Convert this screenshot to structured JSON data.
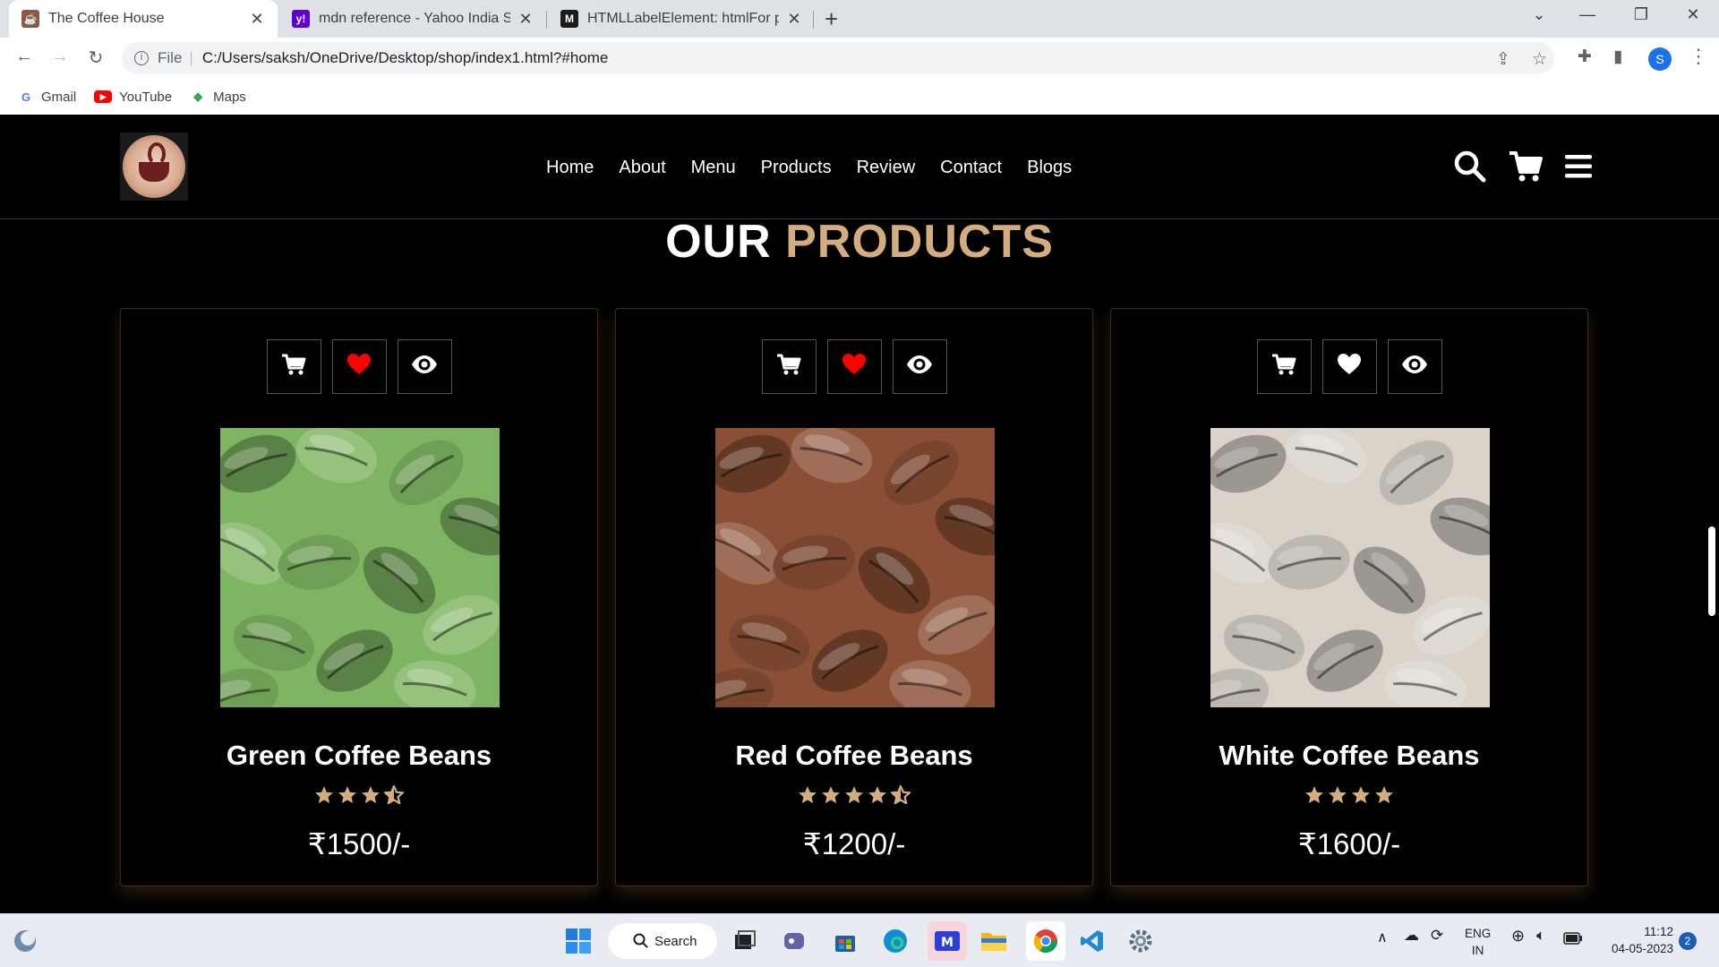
{
  "browser": {
    "tabs": [
      {
        "title": "The Coffee House",
        "active": true
      },
      {
        "title": "mdn reference - Yahoo India Sea",
        "active": false
      },
      {
        "title": "HTMLLabelElement: htmlFor prop",
        "active": false
      }
    ],
    "address": {
      "scheme_label": "File",
      "url": "C:/Users/saksh/OneDrive/Desktop/shop/index1.html?#home"
    },
    "profile_initial": "S",
    "bookmarks": [
      {
        "label": "Gmail",
        "icon": "google-icon"
      },
      {
        "label": "YouTube",
        "icon": "youtube-icon"
      },
      {
        "label": "Maps",
        "icon": "maps-icon"
      }
    ]
  },
  "site": {
    "nav": [
      "Home",
      "About",
      "Menu",
      "Products",
      "Review",
      "Contact",
      "Blogs"
    ],
    "section_title": {
      "main": "OUR",
      "accent": "PRODUCTS"
    },
    "accent_color": "#d3ad7f",
    "products": [
      {
        "name": "Green Coffee Beans",
        "price": "₹1500/-",
        "rating": 3.5,
        "wishlisted": true,
        "bean_color": "#7fb562"
      },
      {
        "name": "Red Coffee Beans",
        "price": "₹1200/-",
        "rating": 4.5,
        "wishlisted": true,
        "bean_color": "#8a4f35"
      },
      {
        "name": "White Coffee Beans",
        "price": "₹1600/-",
        "rating": 4,
        "wishlisted": false,
        "bean_color": "#d9d3c9"
      }
    ]
  },
  "taskbar": {
    "search_label": "Search",
    "language": "ENG",
    "region": "IN",
    "time": "11:12",
    "date": "04-05-2023",
    "notifications": "2"
  }
}
